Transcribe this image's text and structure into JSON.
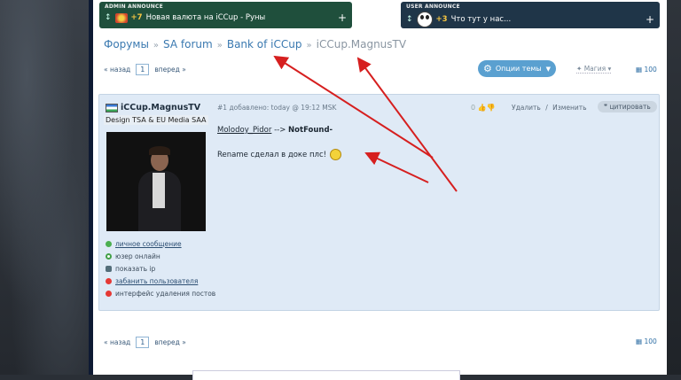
{
  "admin_announce": {
    "header": "ADMIN ANNOUNCE",
    "count": "+7",
    "text": "Новая валюта на iCCup - Руны",
    "plus": "+"
  },
  "user_announce": {
    "header": "USER ANNOUNCE",
    "count": "+3",
    "text": "Что тут у нас...",
    "plus": "+"
  },
  "breadcrumbs": [
    "Форумы",
    "SA forum",
    "Bank of iCCup",
    "iCCup.MagnusTV"
  ],
  "breadcrumb_sep": "»",
  "pager": {
    "prev": "« назад",
    "page": "1",
    "next": "вперед »"
  },
  "topic_options": "Опции темы",
  "magic": "Магия",
  "count": "100",
  "post": {
    "author": "iCCup.MagnusTV",
    "rank": "Design TSA & EU Media SAA",
    "meta": "#1 добавлено: today @ 19:12 MSK",
    "votes": "0",
    "delete": "Удалить",
    "edit_sep": "/",
    "edit": "Изменить",
    "quote": "цитировать",
    "user": "Molodoy_Pidor",
    "arrow": " --> ",
    "target": "NotFound-",
    "message": "Rename сделал в доке плс!",
    "actions": [
      {
        "label": "личное сообщение",
        "color": "#4caf50",
        "link": true
      },
      {
        "label": "юзер онлайн",
        "color": "#43a047",
        "link": false
      },
      {
        "label": "показать ip",
        "color": "#546e7a",
        "link": false
      },
      {
        "label": "забанить пользователя",
        "color": "#e53935",
        "link": true
      },
      {
        "label": "интерфейс удаления постов",
        "color": "#e53935",
        "link": false
      }
    ]
  }
}
